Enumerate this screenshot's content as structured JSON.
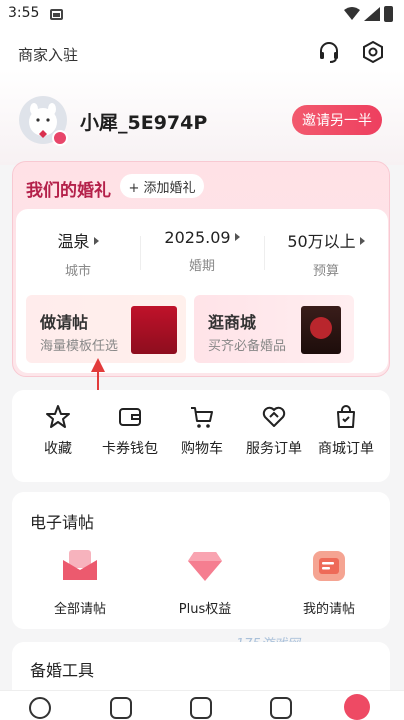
{
  "status_bar": {
    "time": "3:55"
  },
  "header": {
    "merchant_link": "商家入驻"
  },
  "profile": {
    "username": "小犀_5E974P",
    "invite_button": "邀请另一半"
  },
  "wedding": {
    "title": "我们的婚礼",
    "add_button": "+ 添加婚礼",
    "stats": [
      {
        "value": "温泉",
        "label": "城市"
      },
      {
        "value": "2025.09",
        "label": "婚期"
      },
      {
        "value": "50万以上",
        "label": "预算"
      }
    ],
    "promos": [
      {
        "title": "做请帖",
        "subtitle": "海量模板任选"
      },
      {
        "title": "逛商城",
        "subtitle": "买齐必备婚品"
      }
    ]
  },
  "shortcuts": [
    {
      "label": "收藏",
      "icon": "star-icon"
    },
    {
      "label": "卡券钱包",
      "icon": "wallet-icon"
    },
    {
      "label": "购物车",
      "icon": "cart-icon"
    },
    {
      "label": "服务订单",
      "icon": "heart-order-icon"
    },
    {
      "label": "商城订单",
      "icon": "bag-order-icon"
    }
  ],
  "einvite": {
    "title": "电子请帖",
    "items": [
      {
        "label": "全部请帖",
        "icon": "envelope-icon"
      },
      {
        "label": "Plus权益",
        "icon": "diamond-icon"
      },
      {
        "label": "我的请帖",
        "icon": "card-icon"
      }
    ]
  },
  "tools": {
    "title": "备婚工具"
  },
  "watermark": "175游戏网",
  "colors": {
    "accent": "#ee3f5f",
    "title_red": "#b4214a"
  }
}
